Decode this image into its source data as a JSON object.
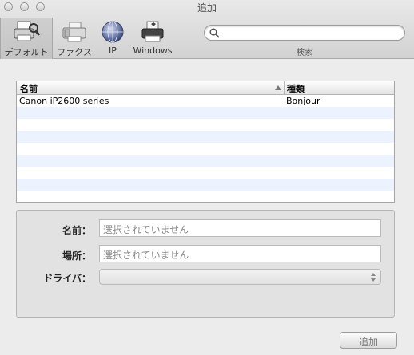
{
  "window": {
    "title": "追加"
  },
  "toolbar": {
    "items": [
      {
        "label": "デフォルト",
        "icon": "default-printer-icon",
        "selected": true
      },
      {
        "label": "ファクス",
        "icon": "fax-icon"
      },
      {
        "label": "IP",
        "icon": "ip-globe-icon"
      },
      {
        "label": "Windows",
        "icon": "windows-printer-icon"
      }
    ],
    "search": {
      "placeholder": "",
      "caption": "検索"
    }
  },
  "printer_list": {
    "columns": [
      "名前",
      "種類"
    ],
    "rows": [
      {
        "name": "Canon iP2600 series",
        "kind": "Bonjour"
      }
    ]
  },
  "details": {
    "name_label": "名前：",
    "name_value": "選択されていません",
    "location_label": "場所：",
    "location_value": "選択されていません",
    "driver_label": "ドライバ：",
    "driver_value": ""
  },
  "footer": {
    "add_button": "追加"
  }
}
